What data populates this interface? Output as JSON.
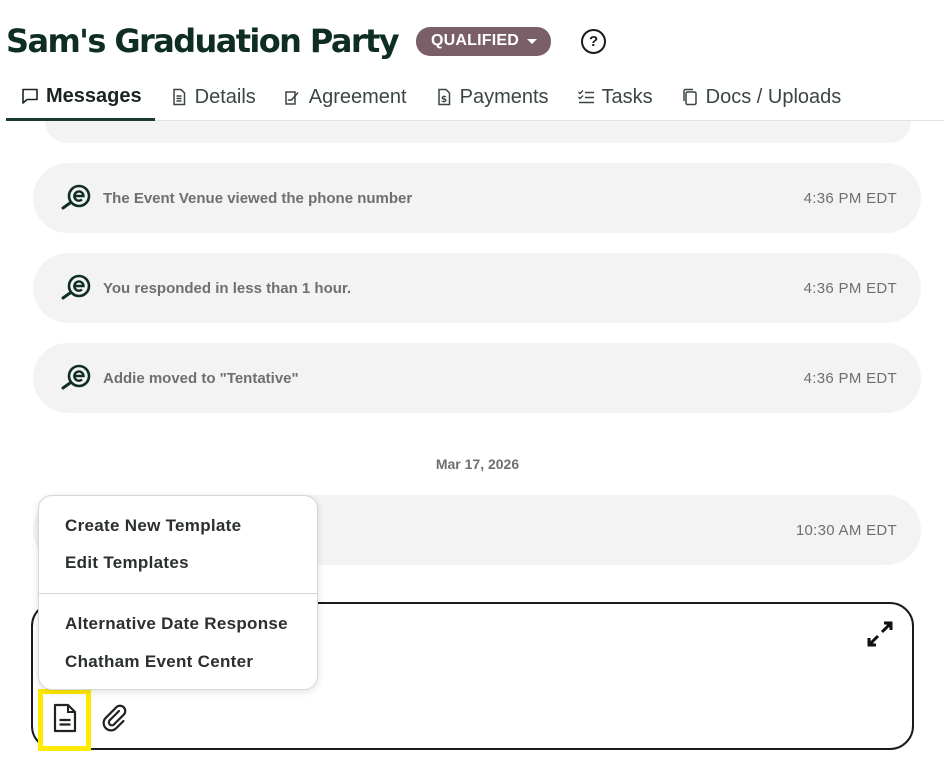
{
  "header": {
    "title": "Sam's Graduation Party",
    "status": "QUALIFIED",
    "help": "?"
  },
  "tabs": [
    {
      "label": "Messages",
      "icon": "chat-icon",
      "active": true
    },
    {
      "label": "Details",
      "icon": "document-icon"
    },
    {
      "label": "Agreement",
      "icon": "signature-icon"
    },
    {
      "label": "Payments",
      "icon": "invoice-icon"
    },
    {
      "label": "Tasks",
      "icon": "checklist-icon"
    },
    {
      "label": "Docs / Uploads",
      "icon": "copy-icon"
    }
  ],
  "messages": [
    {
      "text": "The Event Venue viewed the phone number",
      "time": "4:36 PM EDT"
    },
    {
      "text": "You responded in less than 1 hour.",
      "time": "4:36 PM EDT"
    },
    {
      "text": "Addie moved to \"Tentative\"",
      "time": "4:36 PM EDT"
    }
  ],
  "date_separator": "Mar 17, 2026",
  "latest_message": {
    "time": "10:30 AM EDT"
  },
  "template_menu": {
    "create": "Create New Template",
    "edit": "Edit Templates",
    "templates": [
      "Alternative Date Response",
      "Chatham Event Center"
    ]
  },
  "composer": {
    "expand_icon": "expand-icon",
    "template_icon": "template-icon",
    "attach_icon": "paperclip-icon"
  },
  "colors": {
    "brand_dark": "#0f2e22",
    "status_badge": "#7a5f68",
    "highlight": "#ffea00",
    "bubble": "#f3f3f3"
  }
}
